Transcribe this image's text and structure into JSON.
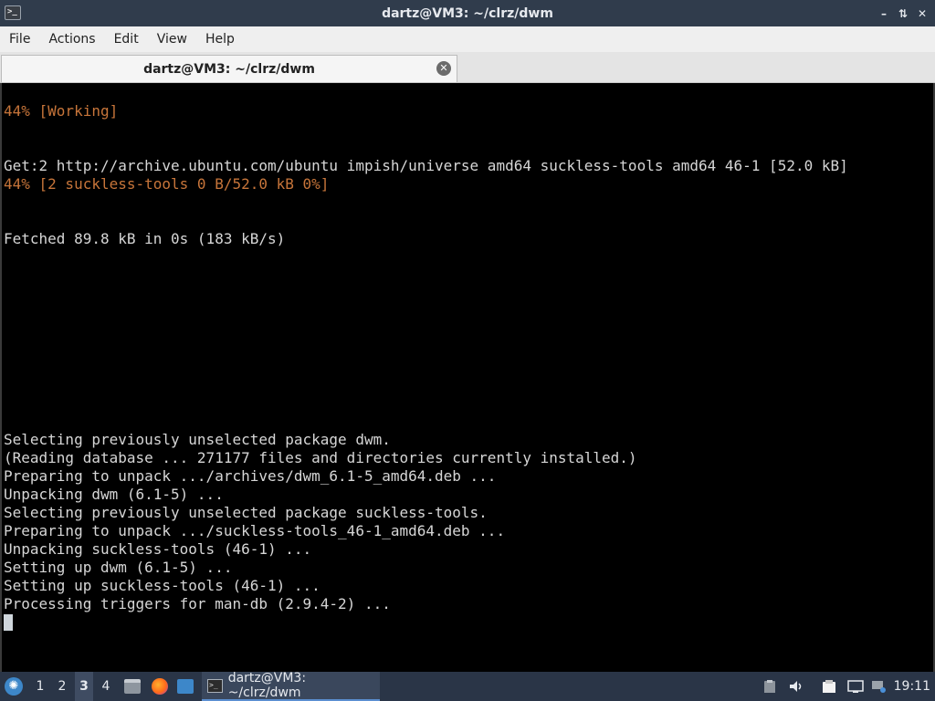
{
  "window": {
    "title": "dartz@VM3: ~/clrz/dwm",
    "controls": [
      "minimize",
      "restore",
      "close"
    ]
  },
  "menu": [
    "File",
    "Actions",
    "Edit",
    "View",
    "Help"
  ],
  "tab": {
    "label": "dartz@VM3: ~/clrz/dwm"
  },
  "terminal": {
    "lines": [
      {
        "text": "",
        "color": "default"
      },
      {
        "text": "44% [Working]",
        "color": "orange"
      },
      {
        "text": "",
        "color": "default"
      },
      {
        "text": "",
        "color": "default"
      },
      {
        "text": "Get:2 http://archive.ubuntu.com/ubuntu impish/universe amd64 suckless-tools amd64 46-1 [52.0 kB]",
        "color": "default"
      },
      {
        "text": "44% [2 suckless-tools 0 B/52.0 kB 0%]",
        "color": "orange"
      },
      {
        "text": "",
        "color": "default"
      },
      {
        "text": "",
        "color": "default"
      },
      {
        "text": "Fetched 89.8 kB in 0s (183 kB/s)",
        "color": "default"
      },
      {
        "text": "",
        "color": "default"
      },
      {
        "text": "",
        "color": "default"
      },
      {
        "text": "",
        "color": "default"
      },
      {
        "text": "",
        "color": "default"
      },
      {
        "text": "",
        "color": "default"
      },
      {
        "text": "",
        "color": "default"
      },
      {
        "text": "",
        "color": "default"
      },
      {
        "text": "",
        "color": "default"
      },
      {
        "text": "",
        "color": "default"
      },
      {
        "text": "",
        "color": "default"
      },
      {
        "text": "Selecting previously unselected package dwm.",
        "color": "default"
      },
      {
        "text": "(Reading database ... 271177 files and directories currently installed.)",
        "color": "default"
      },
      {
        "text": "Preparing to unpack .../archives/dwm_6.1-5_amd64.deb ...",
        "color": "default"
      },
      {
        "text": "Unpacking dwm (6.1-5) ...",
        "color": "default"
      },
      {
        "text": "Selecting previously unselected package suckless-tools.",
        "color": "default"
      },
      {
        "text": "Preparing to unpack .../suckless-tools_46-1_amd64.deb ...",
        "color": "default"
      },
      {
        "text": "Unpacking suckless-tools (46-1) ...",
        "color": "default"
      },
      {
        "text": "Setting up dwm (6.1-5) ...",
        "color": "default"
      },
      {
        "text": "Setting up suckless-tools (46-1) ...",
        "color": "default"
      },
      {
        "text": "Processing triggers for man-db (2.9.4-2) ...",
        "color": "default"
      }
    ]
  },
  "taskbar": {
    "workspaces": [
      "1",
      "2",
      "3",
      "4"
    ],
    "active_workspace": "3",
    "task_label": "dartz@VM3: ~/clrz/dwm",
    "clock": "19:11",
    "tray_icons": [
      "clipboard-icon",
      "volume-icon",
      "notes-icon",
      "monitor-icon",
      "network-icon"
    ]
  },
  "colors": {
    "terminal_bg": "#000000",
    "terminal_fg": "#d6d6d6",
    "terminal_orange": "#c7753a",
    "titlebar_bg": "#303c4c",
    "taskbar_bg": "#2a3547"
  }
}
